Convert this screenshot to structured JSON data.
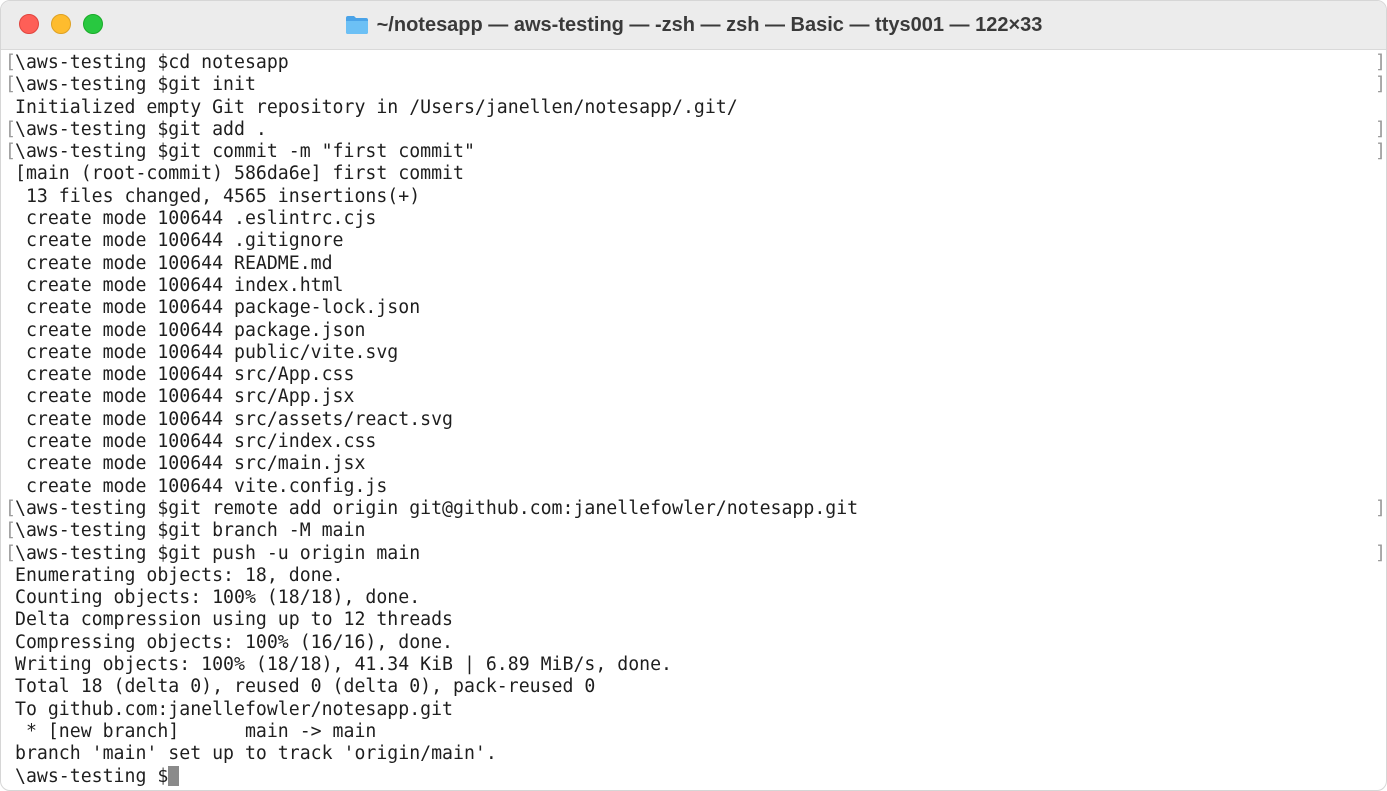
{
  "window": {
    "title": "~/notesapp — aws-testing — -zsh — zsh — Basic — ttys001 — 122×33"
  },
  "icons": {
    "folder": "folder-icon",
    "close": "close-button",
    "minimize": "minimize-button",
    "zoom": "zoom-button"
  },
  "colors": {
    "close": "#fe5f57",
    "minimize": "#febc2e",
    "zoom": "#28c840",
    "folder": "#5fb3ee"
  },
  "terminal": {
    "mark_left": "[",
    "mark_right": "]",
    "lines": [
      "\\aws-testing $cd notesapp",
      "\\aws-testing $git init",
      "Initialized empty Git repository in /Users/janellen/notesapp/.git/",
      "\\aws-testing $git add .",
      "\\aws-testing $git commit -m \"first commit\"",
      "[main (root-commit) 586da6e] first commit",
      " 13 files changed, 4565 insertions(+)",
      " create mode 100644 .eslintrc.cjs",
      " create mode 100644 .gitignore",
      " create mode 100644 README.md",
      " create mode 100644 index.html",
      " create mode 100644 package-lock.json",
      " create mode 100644 package.json",
      " create mode 100644 public/vite.svg",
      " create mode 100644 src/App.css",
      " create mode 100644 src/App.jsx",
      " create mode 100644 src/assets/react.svg",
      " create mode 100644 src/index.css",
      " create mode 100644 src/main.jsx",
      " create mode 100644 vite.config.js",
      "\\aws-testing $git remote add origin git@github.com:janellefowler/notesapp.git",
      "\\aws-testing $git branch -M main",
      "\\aws-testing $git push -u origin main",
      "Enumerating objects: 18, done.",
      "Counting objects: 100% (18/18), done.",
      "Delta compression using up to 12 threads",
      "Compressing objects: 100% (16/16), done.",
      "Writing objects: 100% (18/18), 41.34 KiB | 6.89 MiB/s, done.",
      "Total 18 (delta 0), reused 0 (delta 0), pack-reused 0",
      "To github.com:janellefowler/notesapp.git",
      " * [new branch]      main -> main",
      "branch 'main' set up to track 'origin/main'."
    ],
    "prompt": "\\aws-testing $"
  }
}
